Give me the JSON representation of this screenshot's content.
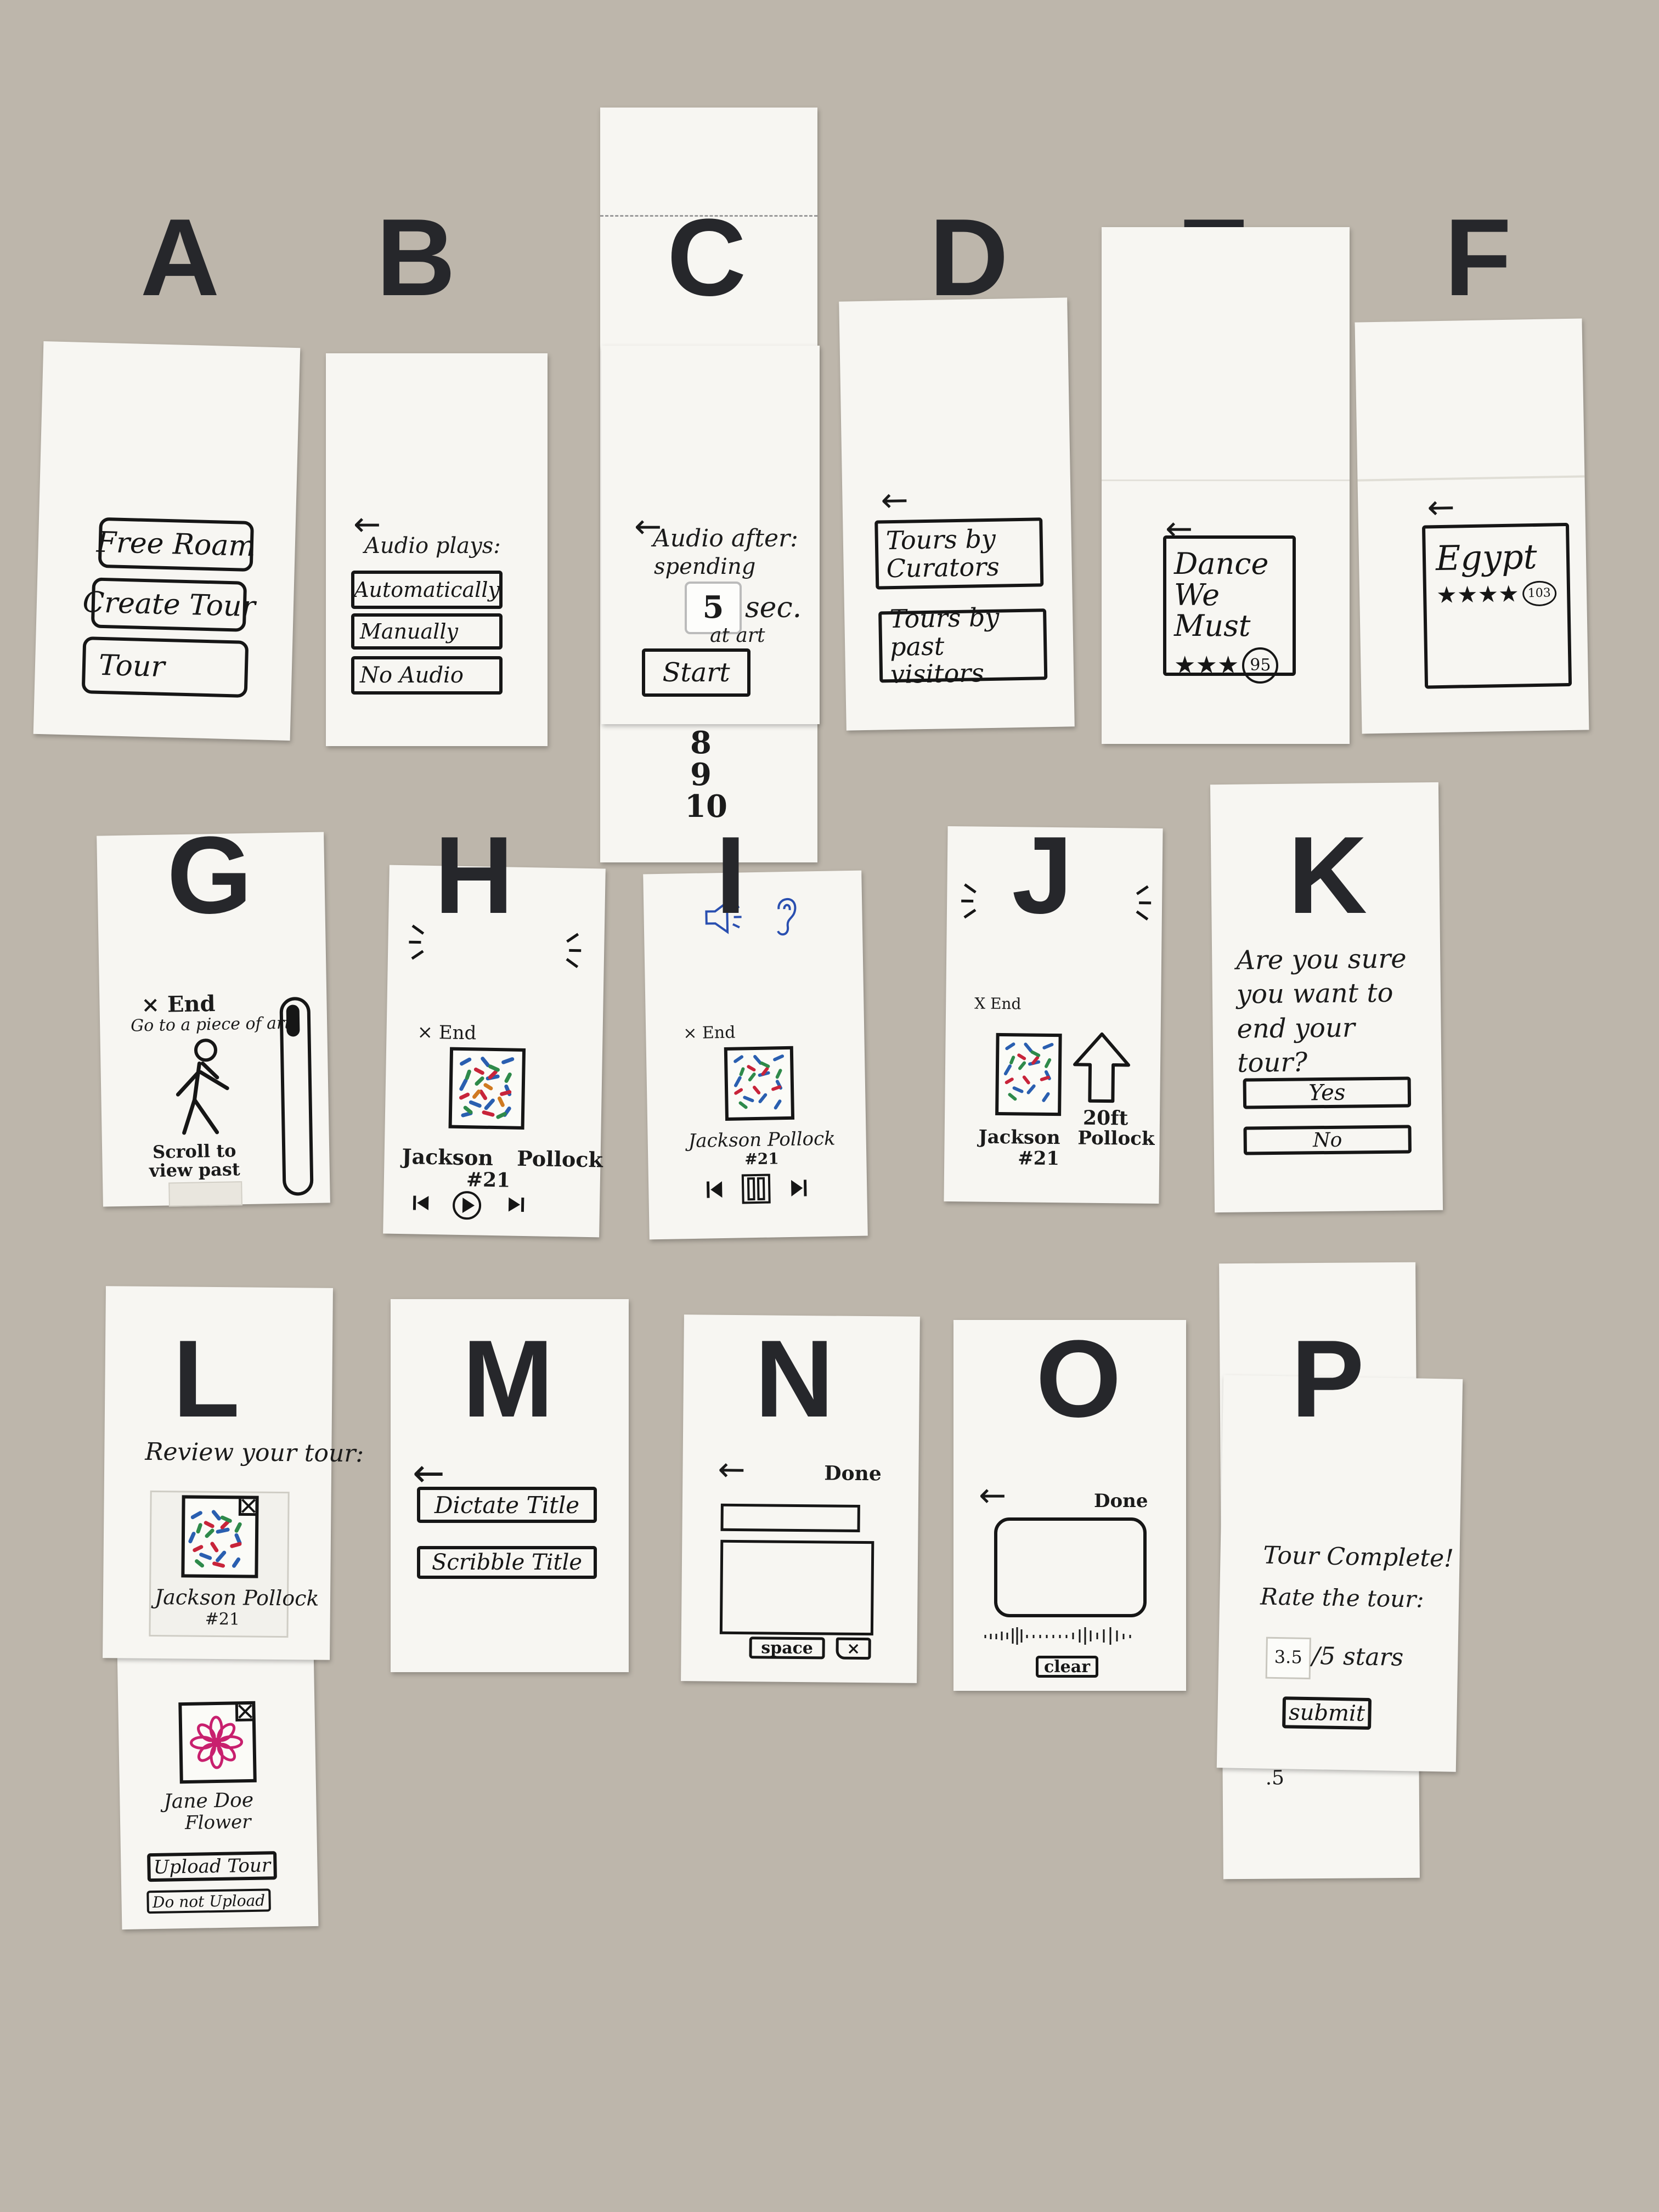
{
  "labels": {
    "a": "A",
    "b": "B",
    "c": "C",
    "d": "D",
    "e": "E",
    "f": "F",
    "g": "G",
    "h": "H",
    "i": "I",
    "j": "J",
    "k": "K",
    "l": "L",
    "m": "M",
    "n": "N",
    "o": "O",
    "p": "P"
  },
  "A": {
    "free_roam": "Free Roam",
    "create_tour": "Create Tour",
    "tour": "Tour"
  },
  "B": {
    "back": "←",
    "heading": "Audio plays:",
    "automatically": "Automatically",
    "manually": "Manually",
    "no_audio": "No Audio"
  },
  "C": {
    "back": "←",
    "line1": "Audio after:",
    "line2": "spending",
    "seconds": "5",
    "sec": "sec.",
    "at_art": "at art",
    "start": "Start",
    "options": [
      "8",
      "9",
      "10"
    ]
  },
  "D": {
    "back": "←",
    "curators": "Tours by Curators",
    "visitors": "Tours by past visitors"
  },
  "E": {
    "back": "←",
    "title": "Dance We Must",
    "stars": "★★★",
    "count": "95"
  },
  "F": {
    "back": "←",
    "title": "Egypt",
    "stars": "★★★★",
    "count": "103"
  },
  "G": {
    "end": "× End",
    "hint": "Go to a piece of art",
    "scroll": "Scroll to view past art"
  },
  "H": {
    "end": "× End",
    "artist": "Jackson Pollock",
    "number": "#21"
  },
  "I": {
    "end": "× End",
    "artist": "Jackson Pollock",
    "number": "#21"
  },
  "J": {
    "end": "X End",
    "distance": "20ft",
    "artist": "Jackson Pollock",
    "number": "#21"
  },
  "K": {
    "question": "Are you sure you want to end your tour?",
    "yes": "Yes",
    "no": "No"
  },
  "L": {
    "heading": "Review your tour:",
    "art1_artist": "Jackson Pollock",
    "art1_number": "#21",
    "art2_artist": "Jane Doe",
    "art2_title": "Flower",
    "upload": "Upload Tour",
    "no_upload": "Do not Upload"
  },
  "M": {
    "back": "←",
    "dictate": "Dictate Title",
    "scribble": "Scribble Title"
  },
  "N": {
    "back": "←",
    "done": "Done",
    "space": "space",
    "delete": "×"
  },
  "O": {
    "back": "←",
    "done": "Done",
    "clear": "clear"
  },
  "P": {
    "line1": "Tour Complete!",
    "line2": "Rate the tour:",
    "rating": "3.5",
    "stars": "/5 stars",
    "submit": "submit",
    "option": ".5"
  },
  "colors": {
    "background": "#bdb6ab",
    "paper": "#f7f6f2",
    "ink": "#161616",
    "paint_blue": "#2a5fb0",
    "paint_red": "#c8243a",
    "paint_green": "#2e8a4a",
    "flower": "#c8206e"
  }
}
